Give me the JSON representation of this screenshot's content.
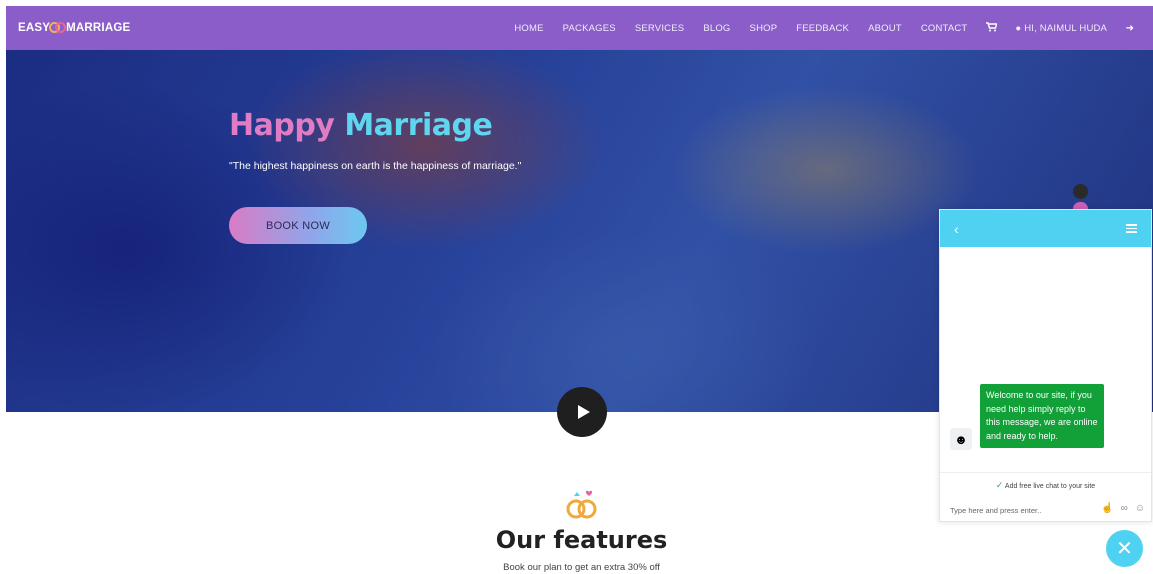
{
  "brand": {
    "left": "EASY",
    "right": "MARRIAGE"
  },
  "nav": {
    "items": [
      "HOME",
      "PACKAGES",
      "SERVICES",
      "BLOG",
      "SHOP",
      "FEEDBACK",
      "ABOUT",
      "CONTACT"
    ],
    "cart_icon": "cart-icon",
    "user_label": "HI, NAIMUL HUDA",
    "user_icon": "user-icon",
    "logout_icon": "logout-icon"
  },
  "hero": {
    "title_part1": "Happy",
    "title_part2": "Marriage",
    "quote": "\"The highest happiness on earth is the happiness of marriage.\"",
    "button": "BOOK NOW"
  },
  "features": {
    "title": "Our features",
    "subtitle": "Book our plan to get an extra 30% off"
  },
  "chat": {
    "message": "Welcome to our site, if you need help simply reply to this message, we are online and ready to help.",
    "promo": "Add free live chat to your site",
    "input_placeholder": "Type here and press enter.."
  },
  "colors": {
    "navbar": "#8a5dc8",
    "title_pink": "#e07cc4",
    "title_cyan": "#5fd6ef",
    "chat_accent": "#4fd2f2",
    "chat_bubble": "#12a038"
  }
}
